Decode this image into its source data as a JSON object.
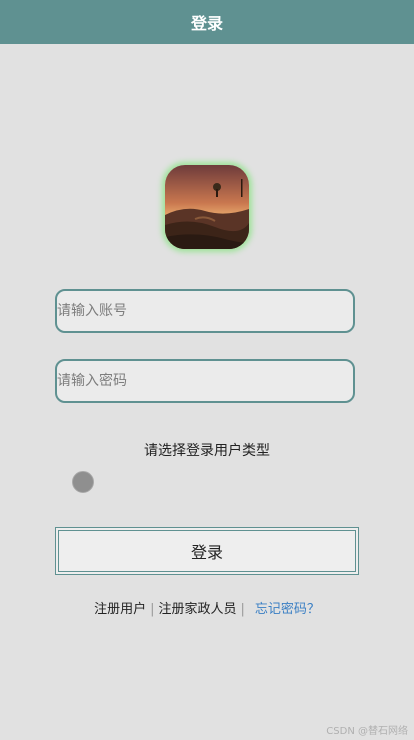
{
  "header": {
    "title": "登录"
  },
  "form": {
    "account_placeholder": "请输入账号",
    "password_placeholder": "请输入密码",
    "type_label": "请选择登录用户类型",
    "login_button": "登录"
  },
  "links": {
    "register_user": "注册用户",
    "register_housekeeper": "注册家政人员",
    "forgot_password": "忘记密码？"
  },
  "watermark": "CSDN @替石网络",
  "colors": {
    "header_bg": "#5f9191",
    "accent_border": "#5f9191",
    "link_blue": "#3a7fc4",
    "avatar_glow": "#9fe39a"
  }
}
